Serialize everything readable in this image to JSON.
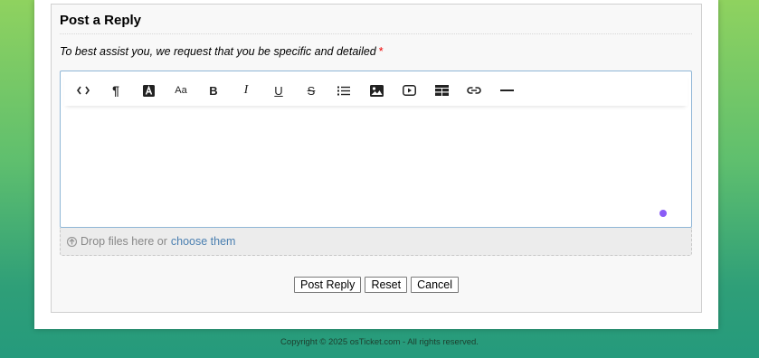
{
  "reply": {
    "title": "Post a Reply",
    "instructions": "To best assist you, we request that you be specific and detailed",
    "required_mark": "*"
  },
  "toolbar": {
    "items": [
      {
        "icon": "code-icon"
      },
      {
        "icon": "paragraph-icon",
        "label": "¶"
      },
      {
        "icon": "font-color-icon"
      },
      {
        "icon": "font-size-icon",
        "label": "Aa"
      },
      {
        "icon": "bold-icon",
        "label": "B"
      },
      {
        "icon": "italic-icon",
        "label": "I"
      },
      {
        "icon": "underline-icon",
        "label": "U"
      },
      {
        "icon": "strikethrough-icon",
        "label": "S"
      },
      {
        "icon": "list-icon"
      },
      {
        "icon": "image-icon"
      },
      {
        "icon": "video-icon"
      },
      {
        "icon": "table-icon"
      },
      {
        "icon": "link-icon"
      },
      {
        "icon": "horizontal-rule-icon"
      }
    ]
  },
  "dropzone": {
    "text": "Drop files here or",
    "link": "choose them"
  },
  "buttons": {
    "post": "Post Reply",
    "reset": "Reset",
    "cancel": "Cancel"
  },
  "footer": {
    "copyright": "Copyright © 2025 osTicket.com - All rights reserved."
  },
  "colors": {
    "cursor_dot": "#8a5cf6",
    "link": "#4a7fb0",
    "required": "#ee0000"
  }
}
